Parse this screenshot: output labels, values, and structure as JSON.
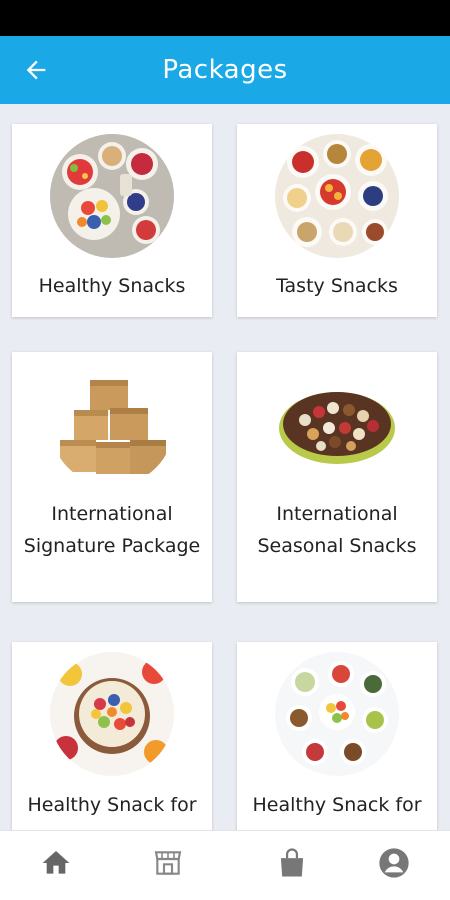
{
  "screen": {
    "title": "Packages",
    "back_icon": "arrow-left-icon",
    "accent_color": "#1aa9e6"
  },
  "packages": [
    {
      "label": "Healthy Snacks",
      "image": "healthy-snacks-image"
    },
    {
      "label": "Tasty Snacks",
      "image": "tasty-snacks-image"
    },
    {
      "label": "International Signature Package",
      "image": "cardboard-boxes-image"
    },
    {
      "label": "International Seasonal Snacks",
      "image": "snack-platter-image"
    },
    {
      "label": "Healthy Snack for",
      "image": "fruit-bowl-image"
    },
    {
      "label": "Healthy Snack for",
      "image": "snack-bowls-image"
    }
  ],
  "bottom_nav": {
    "items": [
      {
        "icon": "home-icon"
      },
      {
        "icon": "store-icon"
      },
      {
        "icon": "shopping-bag-icon"
      },
      {
        "icon": "profile-icon"
      }
    ]
  }
}
